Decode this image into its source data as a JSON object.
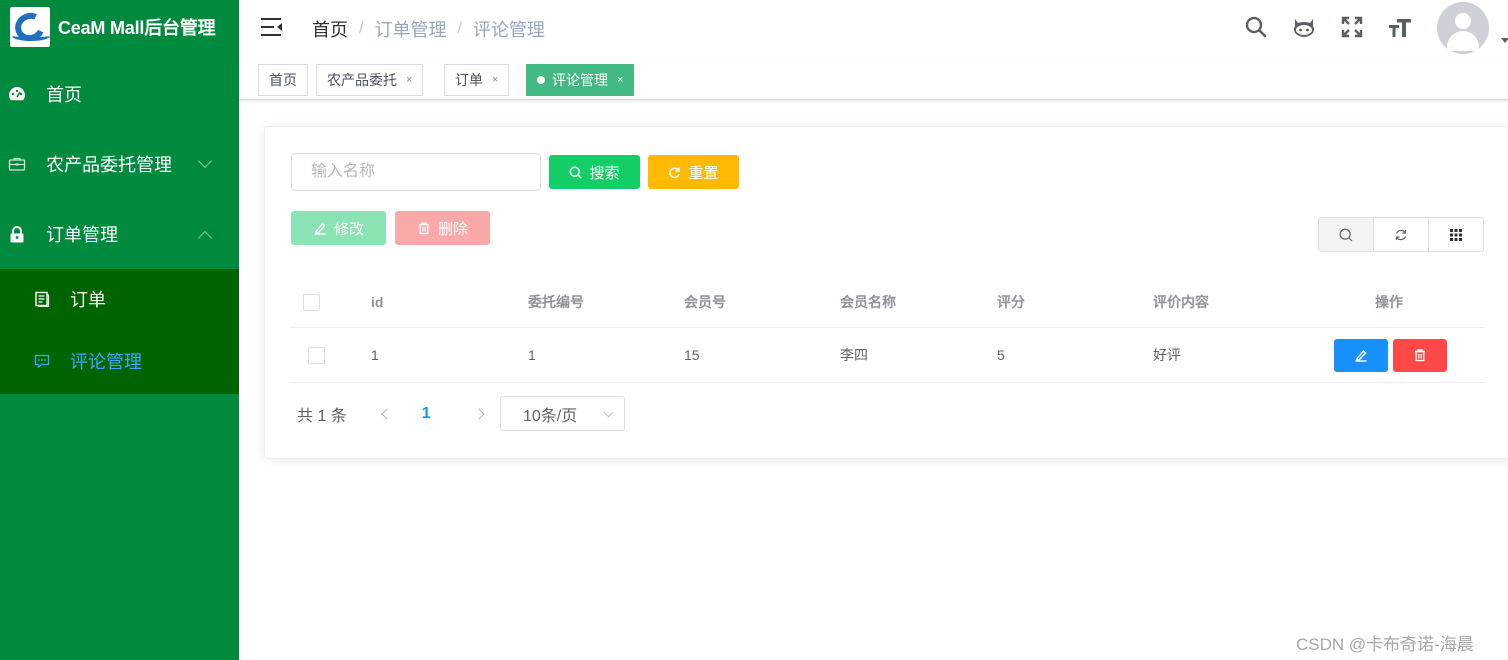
{
  "app": {
    "title": "CeaM Mall后台管理"
  },
  "sidebar": {
    "items": [
      {
        "label": "首页",
        "icon": "dashboard-icon"
      },
      {
        "label": "农产品委托管理",
        "icon": "briefcase-icon",
        "expanded": false
      },
      {
        "label": "订单管理",
        "icon": "lock-icon",
        "expanded": true
      }
    ],
    "subitems": [
      {
        "label": "订单",
        "icon": "document-icon",
        "active": false
      },
      {
        "label": "评论管理",
        "icon": "message-icon",
        "active": true
      }
    ]
  },
  "navbar": {
    "breadcrumb": [
      "首页",
      "订单管理",
      "评论管理"
    ],
    "separator": "/"
  },
  "tags": [
    {
      "label": "首页",
      "closable": false,
      "active": false
    },
    {
      "label": "农产品委托",
      "closable": true,
      "active": false
    },
    {
      "label": "订单",
      "closable": true,
      "active": false
    },
    {
      "label": "评论管理",
      "closable": true,
      "active": true
    }
  ],
  "tag_close": "×",
  "search": {
    "placeholder": "输入名称",
    "value": "",
    "search_label": "搜索",
    "reset_label": "重置"
  },
  "actions": {
    "edit_label": "修改",
    "delete_label": "删除"
  },
  "table": {
    "columns": [
      "id",
      "委托编号",
      "会员号",
      "会员名称",
      "评分",
      "评价内容",
      "操作"
    ],
    "rows": [
      {
        "id": "1",
        "commission_no": "1",
        "member_no": "15",
        "member_name": "李四",
        "score": "5",
        "content": "好评"
      }
    ]
  },
  "pagination": {
    "total_text": "共 1 条",
    "current_page": "1",
    "page_size": "10条/页"
  },
  "watermark": "CSDN @卡布奇诺-海晨",
  "colors": {
    "sidebar_bg": "#008a3e",
    "submenu_bg": "#006400",
    "active_sub": "#3aa6ff",
    "tag_active": "#42b983",
    "search_btn": "#13ce66",
    "reset_btn": "#ffba00",
    "edit_btn": "#1890ff",
    "delete_btn": "#ff4949"
  }
}
